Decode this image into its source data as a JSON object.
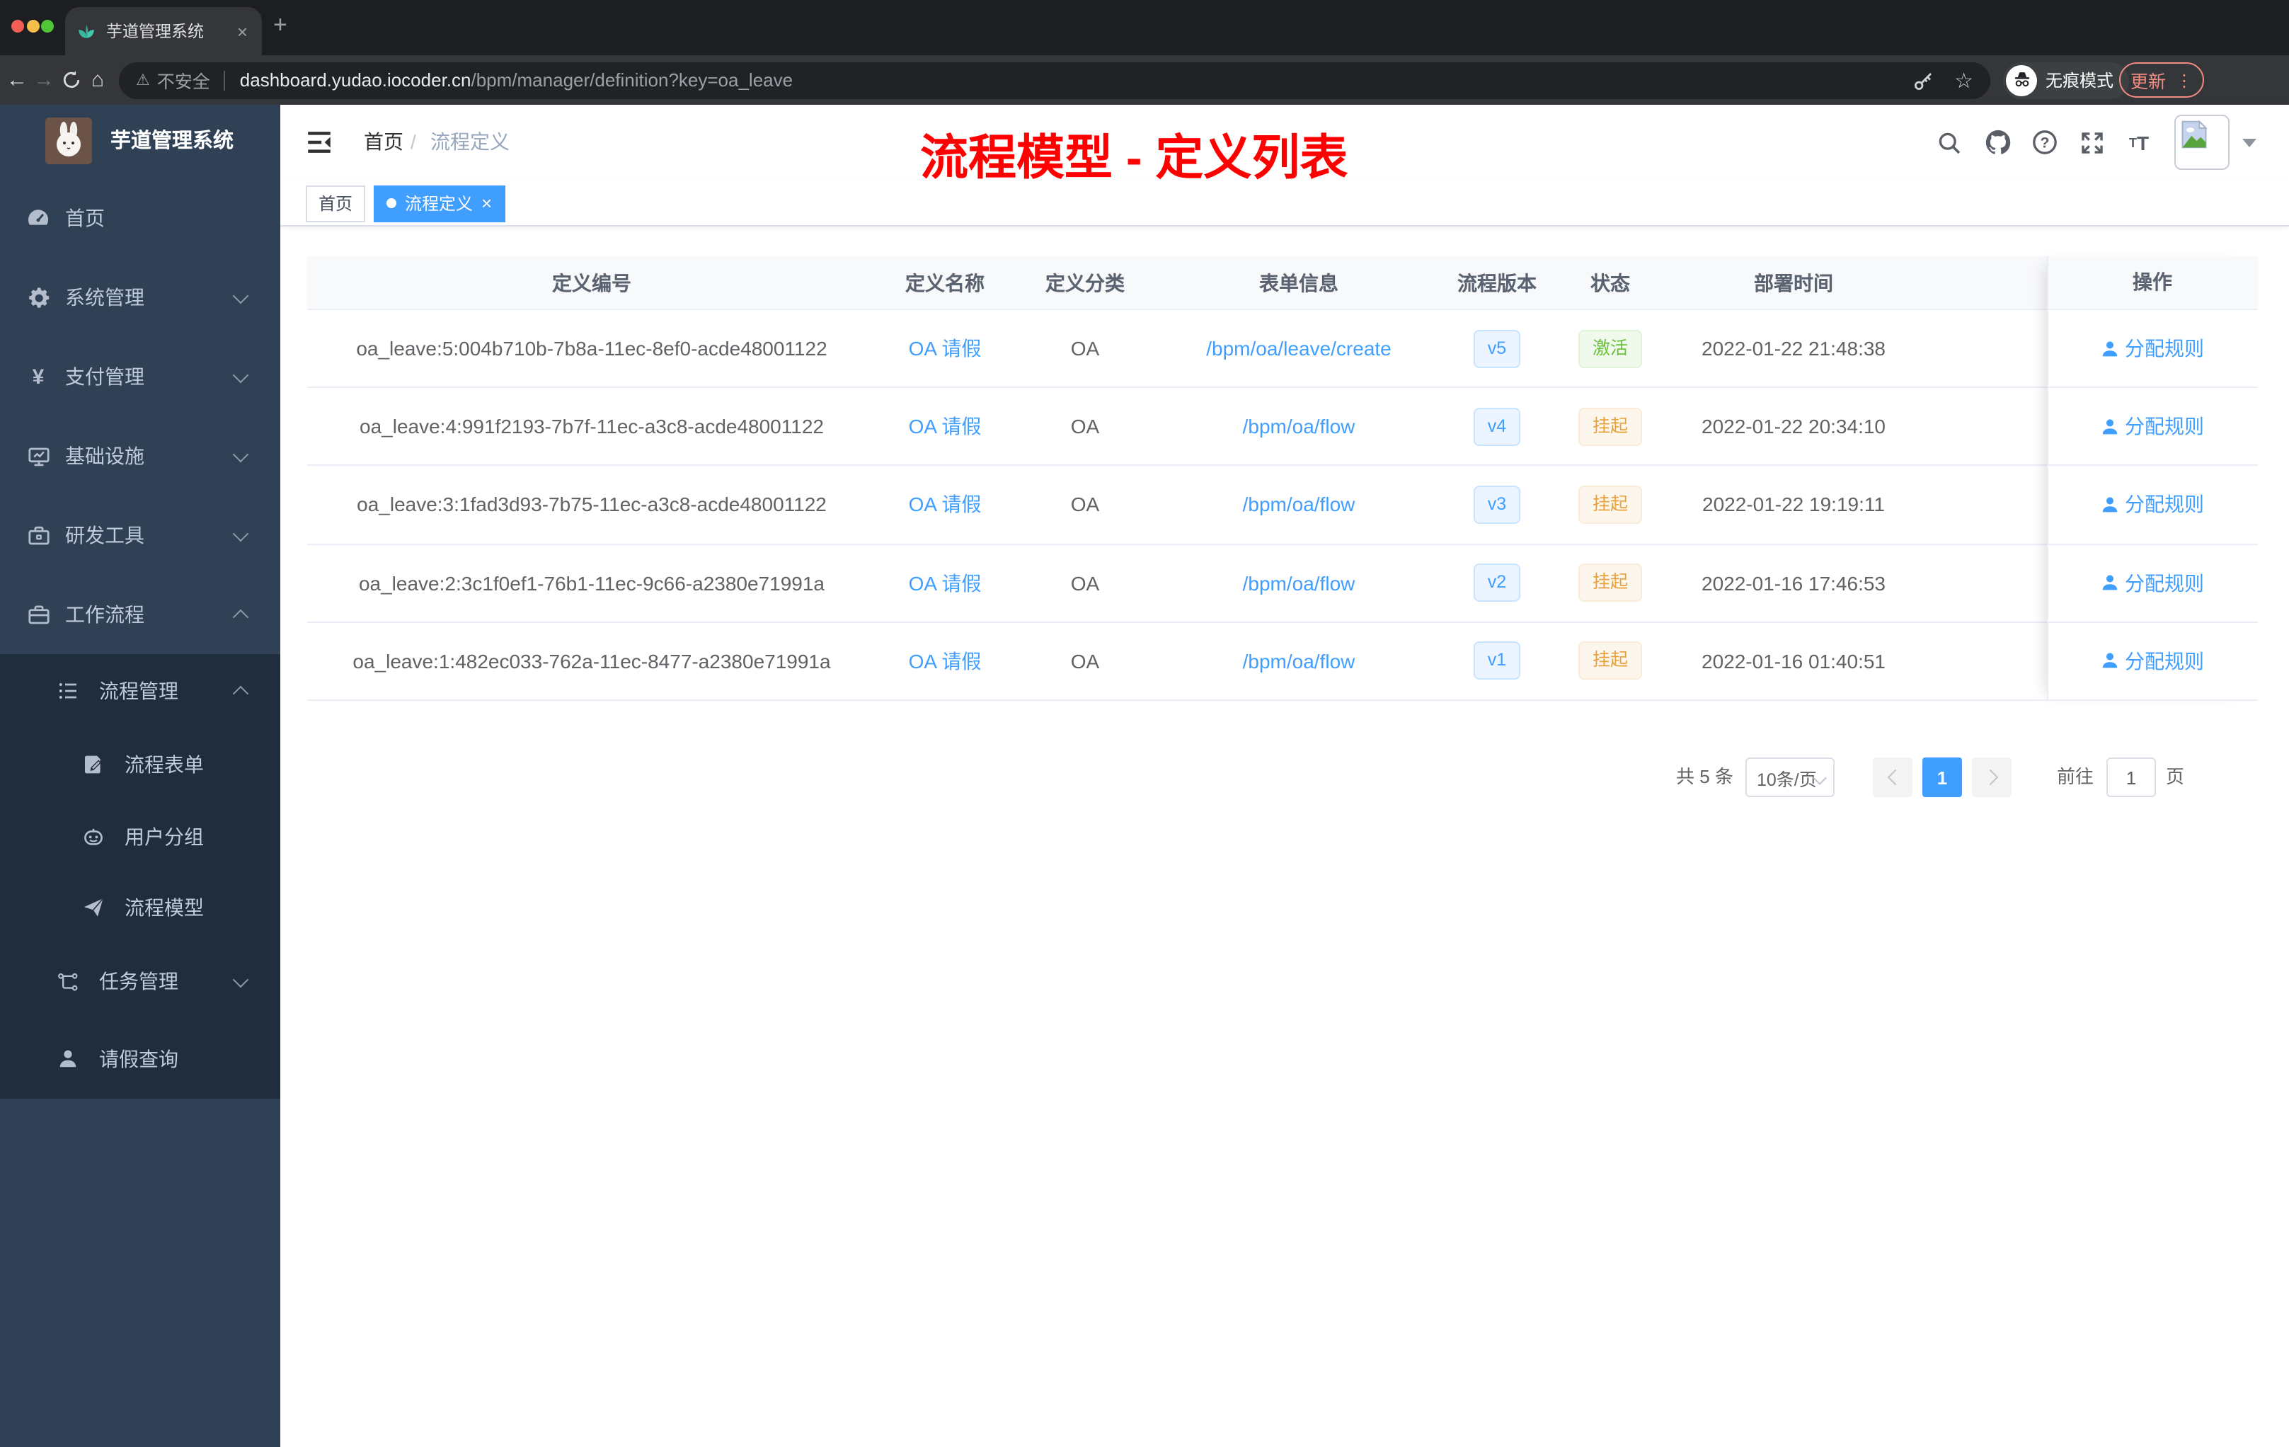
{
  "browser": {
    "tab": {
      "title": "芋道管理系统",
      "close_label": "×"
    },
    "new_tab_label": "+",
    "toolbar": {
      "back": "←",
      "forward": "→",
      "home": "⌂",
      "security_warning": "不安全",
      "url_host": "dashboard.yudao.iocoder.cn",
      "url_path": "/bpm/manager/definition?key=oa_leave",
      "incognito_label": "无痕模式",
      "update_label": "更新",
      "menu_dots": "⋮",
      "star": "☆",
      "warning_glyph": "⚠"
    }
  },
  "sidebar": {
    "logo_title": "芋道管理系统",
    "items": [
      {
        "label": "首页",
        "icon": "dashboard-icon"
      },
      {
        "label": "系统管理",
        "icon": "gear-icon",
        "chevron": "down"
      },
      {
        "label": "支付管理",
        "icon": "yen-icon",
        "chevron": "down",
        "yen": "¥"
      },
      {
        "label": "基础设施",
        "icon": "monitor-icon",
        "chevron": "down"
      },
      {
        "label": "研发工具",
        "icon": "toolbox-icon",
        "chevron": "down"
      },
      {
        "label": "工作流程",
        "icon": "briefcase-icon",
        "chevron": "up"
      }
    ],
    "submenu": [
      {
        "label": "流程管理",
        "icon": "list-icon",
        "chevron": "up"
      },
      {
        "label": "流程表单",
        "icon": "form-icon"
      },
      {
        "label": "用户分组",
        "icon": "robot-icon"
      },
      {
        "label": "流程模型",
        "icon": "send-icon"
      },
      {
        "label": "任务管理",
        "icon": "tree-icon",
        "chevron": "down"
      },
      {
        "label": "请假查询",
        "icon": "user-icon"
      }
    ]
  },
  "navbar": {
    "breadcrumb": {
      "home": "首页",
      "separator": "/",
      "current": "流程定义"
    }
  },
  "annotation": {
    "text": "流程模型 - 定义列表",
    "color": "#ff0000"
  },
  "tags": {
    "home": {
      "label": "首页"
    },
    "active": {
      "label": "流程定义",
      "close": "×"
    }
  },
  "table": {
    "headers": [
      "定义编号",
      "定义名称",
      "定义分类",
      "表单信息",
      "流程版本",
      "状态",
      "部署时间",
      "操作"
    ],
    "rows": [
      {
        "id": "oa_leave:5:004b710b-7b8a-11ec-8ef0-acde48001122",
        "name": "OA 请假",
        "category": "OA",
        "form": "/bpm/oa/leave/create",
        "version": "v5",
        "status": "激活",
        "status_type": "success",
        "deployed": "2022-01-22 21:48:38",
        "action": "分配规则"
      },
      {
        "id": "oa_leave:4:991f2193-7b7f-11ec-a3c8-acde48001122",
        "name": "OA 请假",
        "category": "OA",
        "form": "/bpm/oa/flow",
        "version": "v4",
        "status": "挂起",
        "status_type": "warning",
        "deployed": "2022-01-22 20:34:10",
        "action": "分配规则"
      },
      {
        "id": "oa_leave:3:1fad3d93-7b75-11ec-a3c8-acde48001122",
        "name": "OA 请假",
        "category": "OA",
        "form": "/bpm/oa/flow",
        "version": "v3",
        "status": "挂起",
        "status_type": "warning",
        "deployed": "2022-01-22 19:19:11",
        "action": "分配规则"
      },
      {
        "id": "oa_leave:2:3c1f0ef1-76b1-11ec-9c66-a2380e71991a",
        "name": "OA 请假",
        "category": "OA",
        "form": "/bpm/oa/flow",
        "version": "v2",
        "status": "挂起",
        "status_type": "warning",
        "deployed": "2022-01-16 17:46:53",
        "action": "分配规则"
      },
      {
        "id": "oa_leave:1:482ec033-762a-11ec-8477-a2380e71991a",
        "name": "OA 请假",
        "category": "OA",
        "form": "/bpm/oa/flow",
        "version": "v1",
        "status": "挂起",
        "status_type": "warning",
        "deployed": "2022-01-16 01:40:51",
        "action": "分配规则"
      }
    ]
  },
  "pagination": {
    "total": "共 5 条",
    "page_size": "10条/页",
    "current": "1",
    "goto": "前往",
    "goto_value": "1",
    "unit": "页"
  },
  "colors": {
    "accent": "#409eff",
    "success": "#67c23a",
    "warning": "#e6a23c",
    "sidebar_bg": "#304156",
    "submenu_bg": "#1f2d3d",
    "annotation_red": "#ff0000"
  }
}
